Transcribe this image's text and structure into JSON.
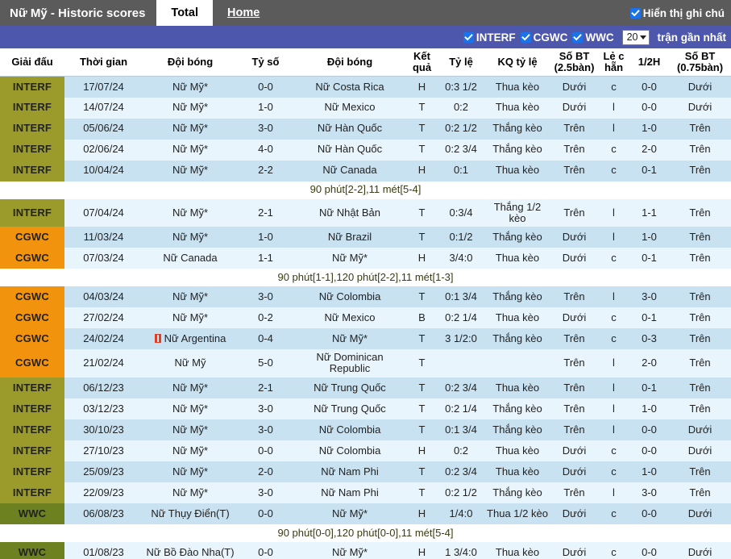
{
  "topbar": {
    "title": "Nữ Mỹ - Historic scores",
    "tabs": [
      {
        "label": "Total",
        "active": true
      },
      {
        "label": "Home",
        "active": false
      }
    ],
    "show_notes_label": "Hiển thị ghi chú",
    "show_notes_checked": true
  },
  "filterbar": {
    "filters": [
      {
        "label": "INTERF",
        "checked": true
      },
      {
        "label": "CGWC",
        "checked": true
      },
      {
        "label": "WWC",
        "checked": true
      }
    ],
    "count_value": "20",
    "tail_label": "trận gần nhất"
  },
  "colors": {
    "topbar_bg": "#5b5b5b",
    "filterbar_bg": "#4d58ad",
    "league_interf": "#9b9b2c",
    "league_cgwc": "#f2930e",
    "league_wwc": "#6d8121",
    "row_odd": "#c9e2f2",
    "row_even": "#e9f5fc",
    "checkbox_accent": "#1a73e8"
  },
  "table": {
    "headers": [
      "Giải đấu",
      "Thời gian",
      "Đội bóng",
      "Tỷ số",
      "Đội bóng",
      "Kết quả",
      "Tỷ lệ",
      "KQ tỷ lệ",
      "Số BT (2.5bàn)",
      "Lẻ c hẵn",
      "1/2H",
      "Số BT (0.75bàn)"
    ],
    "rows": [
      {
        "kind": "match",
        "league": "INTERF",
        "date": "17/07/24",
        "home": "Nữ Mỹ*",
        "home_color": "c-blue",
        "score": "0-0",
        "score_color": "c-blue",
        "away": "Nữ Costa Rica",
        "away_color": "c-dark",
        "result": "H",
        "result_color": "c-blue",
        "odds": "0:3 1/2",
        "odds_color": "c-blue",
        "odds_result": "Thua kèo",
        "odds_result_color": "c-green",
        "ou": "Dưới",
        "ou_color": "c-green",
        "oe": "c",
        "oe_color": "c-red",
        "half": "0-0",
        "half_color": "c-dark",
        "ou2": "Dưới",
        "ou2_color": "c-green",
        "redcard": false
      },
      {
        "kind": "match",
        "league": "INTERF",
        "date": "14/07/24",
        "home": "Nữ Mỹ*",
        "home_color": "c-red",
        "score": "1-0",
        "score_color": "c-red",
        "away": "Nữ Mexico",
        "away_color": "c-dark",
        "result": "T",
        "result_color": "c-red",
        "odds": "0:2",
        "odds_color": "c-blue",
        "odds_result": "Thua kèo",
        "odds_result_color": "c-green",
        "ou": "Dưới",
        "ou_color": "c-green",
        "oe": "l",
        "oe_color": "c-olive",
        "half": "0-0",
        "half_color": "c-dark",
        "ou2": "Dưới",
        "ou2_color": "c-green",
        "redcard": false
      },
      {
        "kind": "match",
        "league": "INTERF",
        "date": "05/06/24",
        "home": "Nữ Mỹ*",
        "home_color": "c-red",
        "score": "3-0",
        "score_color": "c-red",
        "away": "Nữ Hàn Quốc",
        "away_color": "c-dark",
        "result": "T",
        "result_color": "c-red",
        "odds": "0:2 1/2",
        "odds_color": "c-blue",
        "odds_result": "Thắng kèo",
        "odds_result_color": "c-red",
        "ou": "Trên",
        "ou_color": "c-red",
        "oe": "l",
        "oe_color": "c-olive",
        "half": "1-0",
        "half_color": "c-dark",
        "ou2": "Trên",
        "ou2_color": "c-red",
        "redcard": false
      },
      {
        "kind": "match",
        "league": "INTERF",
        "date": "02/06/24",
        "home": "Nữ Mỹ*",
        "home_color": "c-red",
        "score": "4-0",
        "score_color": "c-red",
        "away": "Nữ Hàn Quốc",
        "away_color": "c-dark",
        "result": "T",
        "result_color": "c-red",
        "odds": "0:2 3/4",
        "odds_color": "c-blue",
        "odds_result": "Thắng kèo",
        "odds_result_color": "c-red",
        "ou": "Trên",
        "ou_color": "c-red",
        "oe": "c",
        "oe_color": "c-red",
        "half": "2-0",
        "half_color": "c-dark",
        "ou2": "Trên",
        "ou2_color": "c-red",
        "redcard": false
      },
      {
        "kind": "match",
        "league": "INTERF",
        "date": "10/04/24",
        "home": "Nữ Mỹ*",
        "home_color": "c-blue",
        "score": "2-2",
        "score_color": "c-blue",
        "away": "Nữ Canada",
        "away_color": "c-dark",
        "result": "H",
        "result_color": "c-blue",
        "odds": "0:1",
        "odds_color": "c-blue",
        "odds_result": "Thua kèo",
        "odds_result_color": "c-green",
        "ou": "Trên",
        "ou_color": "c-red",
        "oe": "c",
        "oe_color": "c-red",
        "half": "0-1",
        "half_color": "c-dark",
        "ou2": "Trên",
        "ou2_color": "c-red",
        "redcard": false
      },
      {
        "kind": "note",
        "text": "90 phút[2-2],11 mét[5-4]"
      },
      {
        "kind": "match",
        "league": "INTERF",
        "date": "07/04/24",
        "home": "Nữ Mỹ*",
        "home_color": "c-red",
        "score": "2-1",
        "score_color": "c-red",
        "away": "Nữ Nhật Bản",
        "away_color": "c-dark",
        "result": "T",
        "result_color": "c-red",
        "odds": "0:3/4",
        "odds_color": "c-blue",
        "odds_result": "Thắng 1/2 kèo",
        "odds_result_color": "c-red",
        "ou": "Trên",
        "ou_color": "c-red",
        "oe": "l",
        "oe_color": "c-olive",
        "half": "1-1",
        "half_color": "c-dark",
        "ou2": "Trên",
        "ou2_color": "c-red",
        "redcard": false
      },
      {
        "kind": "match",
        "league": "CGWC",
        "date": "11/03/24",
        "home": "Nữ Mỹ*",
        "home_color": "c-red",
        "score": "1-0",
        "score_color": "c-red",
        "away": "Nữ Brazil",
        "away_color": "c-dark",
        "result": "T",
        "result_color": "c-red",
        "odds": "0:1/2",
        "odds_color": "c-blue",
        "odds_result": "Thắng kèo",
        "odds_result_color": "c-red",
        "ou": "Dưới",
        "ou_color": "c-green",
        "oe": "l",
        "oe_color": "c-olive",
        "half": "1-0",
        "half_color": "c-dark",
        "ou2": "Trên",
        "ou2_color": "c-red",
        "redcard": false
      },
      {
        "kind": "match",
        "league": "CGWC",
        "date": "07/03/24",
        "home": "Nữ Canada",
        "home_color": "c-dark",
        "score": "1-1",
        "score_color": "c-blue",
        "away": "Nữ Mỹ*",
        "away_color": "c-blue",
        "result": "H",
        "result_color": "c-blue",
        "odds": "3/4:0",
        "odds_color": "c-blue",
        "odds_result": "Thua kèo",
        "odds_result_color": "c-green",
        "ou": "Dưới",
        "ou_color": "c-green",
        "oe": "c",
        "oe_color": "c-red",
        "half": "0-1",
        "half_color": "c-dark",
        "ou2": "Trên",
        "ou2_color": "c-red",
        "redcard": false
      },
      {
        "kind": "note",
        "text": "90 phút[1-1],120 phút[2-2],11 mét[1-3]"
      },
      {
        "kind": "match",
        "league": "CGWC",
        "date": "04/03/24",
        "home": "Nữ Mỹ*",
        "home_color": "c-red",
        "score": "3-0",
        "score_color": "c-red",
        "away": "Nữ Colombia",
        "away_color": "c-dark",
        "result": "T",
        "result_color": "c-red",
        "odds": "0:1 3/4",
        "odds_color": "c-blue",
        "odds_result": "Thắng kèo",
        "odds_result_color": "c-red",
        "ou": "Trên",
        "ou_color": "c-red",
        "oe": "l",
        "oe_color": "c-olive",
        "half": "3-0",
        "half_color": "c-dark",
        "ou2": "Trên",
        "ou2_color": "c-red",
        "redcard": false
      },
      {
        "kind": "match",
        "league": "CGWC",
        "date": "27/02/24",
        "home": "Nữ Mỹ*",
        "home_color": "c-green",
        "score": "0-2",
        "score_color": "c-blue",
        "away": "Nữ Mexico",
        "away_color": "c-dark",
        "result": "B",
        "result_color": "c-green",
        "odds": "0:2 1/4",
        "odds_color": "c-blue",
        "odds_result": "Thua kèo",
        "odds_result_color": "c-green",
        "ou": "Dưới",
        "ou_color": "c-green",
        "oe": "c",
        "oe_color": "c-red",
        "half": "0-1",
        "half_color": "c-dark",
        "ou2": "Trên",
        "ou2_color": "c-red",
        "redcard": false
      },
      {
        "kind": "match",
        "league": "CGWC",
        "date": "24/02/24",
        "home": "Nữ Argentina",
        "home_color": "c-dark",
        "score": "0-4",
        "score_color": "c-blue",
        "away": "Nữ Mỹ*",
        "away_color": "c-red",
        "result": "T",
        "result_color": "c-red",
        "odds": "3 1/2:0",
        "odds_color": "c-blue",
        "odds_result": "Thắng kèo",
        "odds_result_color": "c-red",
        "ou": "Trên",
        "ou_color": "c-red",
        "oe": "c",
        "oe_color": "c-red",
        "half": "0-3",
        "half_color": "c-dark",
        "ou2": "Trên",
        "ou2_color": "c-red",
        "redcard": true
      },
      {
        "kind": "match",
        "league": "CGWC",
        "date": "21/02/24",
        "home": "Nữ Mỹ",
        "home_color": "c-red",
        "score": "5-0",
        "score_color": "c-red",
        "away": "Nữ Dominican Republic",
        "away_color": "c-dark",
        "result": "T",
        "result_color": "c-red",
        "odds": "",
        "odds_color": "c-blue",
        "odds_result": "",
        "odds_result_color": "c-red",
        "ou": "Trên",
        "ou_color": "c-red",
        "oe": "l",
        "oe_color": "c-olive",
        "half": "2-0",
        "half_color": "c-dark",
        "ou2": "Trên",
        "ou2_color": "c-red",
        "redcard": false
      },
      {
        "kind": "match",
        "league": "INTERF",
        "date": "06/12/23",
        "home": "Nữ Mỹ*",
        "home_color": "c-red",
        "score": "2-1",
        "score_color": "c-red",
        "away": "Nữ Trung Quốc",
        "away_color": "c-dark",
        "result": "T",
        "result_color": "c-red",
        "odds": "0:2 3/4",
        "odds_color": "c-blue",
        "odds_result": "Thua kèo",
        "odds_result_color": "c-green",
        "ou": "Trên",
        "ou_color": "c-red",
        "oe": "l",
        "oe_color": "c-olive",
        "half": "0-1",
        "half_color": "c-dark",
        "ou2": "Trên",
        "ou2_color": "c-red",
        "redcard": false
      },
      {
        "kind": "match",
        "league": "INTERF",
        "date": "03/12/23",
        "home": "Nữ Mỹ*",
        "home_color": "c-red",
        "score": "3-0",
        "score_color": "c-red",
        "away": "Nữ Trung Quốc",
        "away_color": "c-dark",
        "result": "T",
        "result_color": "c-red",
        "odds": "0:2 1/4",
        "odds_color": "c-blue",
        "odds_result": "Thắng kèo",
        "odds_result_color": "c-red",
        "ou": "Trên",
        "ou_color": "c-red",
        "oe": "l",
        "oe_color": "c-olive",
        "half": "1-0",
        "half_color": "c-dark",
        "ou2": "Trên",
        "ou2_color": "c-red",
        "redcard": false
      },
      {
        "kind": "match",
        "league": "INTERF",
        "date": "30/10/23",
        "home": "Nữ Mỹ*",
        "home_color": "c-red",
        "score": "3-0",
        "score_color": "c-red",
        "away": "Nữ Colombia",
        "away_color": "c-dark",
        "result": "T",
        "result_color": "c-red",
        "odds": "0:1 3/4",
        "odds_color": "c-blue",
        "odds_result": "Thắng kèo",
        "odds_result_color": "c-red",
        "ou": "Trên",
        "ou_color": "c-red",
        "oe": "l",
        "oe_color": "c-olive",
        "half": "0-0",
        "half_color": "c-dark",
        "ou2": "Dưới",
        "ou2_color": "c-green",
        "redcard": false
      },
      {
        "kind": "match",
        "league": "INTERF",
        "date": "27/10/23",
        "home": "Nữ Mỹ*",
        "home_color": "c-blue",
        "score": "0-0",
        "score_color": "c-blue",
        "away": "Nữ Colombia",
        "away_color": "c-dark",
        "result": "H",
        "result_color": "c-blue",
        "odds": "0:2",
        "odds_color": "c-blue",
        "odds_result": "Thua kèo",
        "odds_result_color": "c-green",
        "ou": "Dưới",
        "ou_color": "c-green",
        "oe": "c",
        "oe_color": "c-red",
        "half": "0-0",
        "half_color": "c-dark",
        "ou2": "Dưới",
        "ou2_color": "c-green",
        "redcard": false
      },
      {
        "kind": "match",
        "league": "INTERF",
        "date": "25/09/23",
        "home": "Nữ Mỹ*",
        "home_color": "c-red",
        "score": "2-0",
        "score_color": "c-red",
        "away": "Nữ Nam Phi",
        "away_color": "c-dark",
        "result": "T",
        "result_color": "c-red",
        "odds": "0:2 3/4",
        "odds_color": "c-blue",
        "odds_result": "Thua kèo",
        "odds_result_color": "c-green",
        "ou": "Dưới",
        "ou_color": "c-green",
        "oe": "c",
        "oe_color": "c-red",
        "half": "1-0",
        "half_color": "c-dark",
        "ou2": "Trên",
        "ou2_color": "c-red",
        "redcard": false
      },
      {
        "kind": "match",
        "league": "INTERF",
        "date": "22/09/23",
        "home": "Nữ Mỹ*",
        "home_color": "c-red",
        "score": "3-0",
        "score_color": "c-red",
        "away": "Nữ Nam Phi",
        "away_color": "c-dark",
        "result": "T",
        "result_color": "c-red",
        "odds": "0:2 1/2",
        "odds_color": "c-blue",
        "odds_result": "Thắng kèo",
        "odds_result_color": "c-red",
        "ou": "Trên",
        "ou_color": "c-red",
        "oe": "l",
        "oe_color": "c-olive",
        "half": "3-0",
        "half_color": "c-dark",
        "ou2": "Trên",
        "ou2_color": "c-red",
        "redcard": false
      },
      {
        "kind": "match",
        "league": "WWC",
        "date": "06/08/23",
        "home": "Nữ Thụy Điển(T)",
        "home_color": "c-dark",
        "score": "0-0",
        "score_color": "c-blue",
        "away": "Nữ Mỹ*",
        "away_color": "c-blue",
        "result": "H",
        "result_color": "c-blue",
        "odds": "1/4:0",
        "odds_color": "c-blue",
        "odds_result": "Thua 1/2 kèo",
        "odds_result_color": "c-green",
        "ou": "Dưới",
        "ou_color": "c-green",
        "oe": "c",
        "oe_color": "c-red",
        "half": "0-0",
        "half_color": "c-dark",
        "ou2": "Dưới",
        "ou2_color": "c-green",
        "redcard": false
      },
      {
        "kind": "note",
        "text": "90 phút[0-0],120 phút[0-0],11 mét[5-4]"
      },
      {
        "kind": "match",
        "league": "WWC",
        "date": "01/08/23",
        "home": "Nữ Bồ Đào Nha(T)",
        "home_color": "c-dark",
        "score": "0-0",
        "score_color": "c-blue",
        "away": "Nữ Mỹ*",
        "away_color": "c-blue",
        "result": "H",
        "result_color": "c-blue",
        "odds": "1 3/4:0",
        "odds_color": "c-blue",
        "odds_result": "Thua kèo",
        "odds_result_color": "c-green",
        "ou": "Dưới",
        "ou_color": "c-green",
        "oe": "c",
        "oe_color": "c-red",
        "half": "0-0",
        "half_color": "c-dark",
        "ou2": "Dưới",
        "ou2_color": "c-green",
        "redcard": false
      }
    ]
  }
}
